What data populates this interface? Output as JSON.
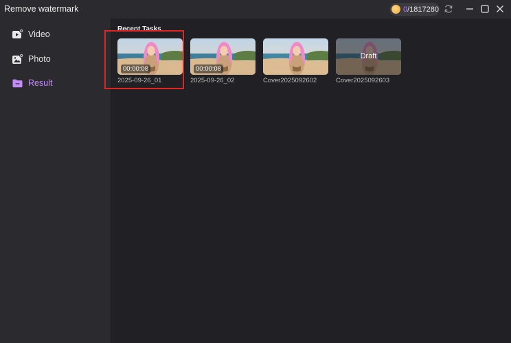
{
  "app": {
    "title": "Remove watermark"
  },
  "credits": {
    "used": "0",
    "total": "/1817280"
  },
  "window_icons": [
    "refresh-icon",
    "minimize-icon",
    "maximize-icon",
    "close-icon"
  ],
  "sidebar": {
    "items": [
      {
        "label": "Video",
        "icon": "video-icon",
        "active": false
      },
      {
        "label": "Photo",
        "icon": "photo-icon",
        "active": false
      },
      {
        "label": "Result",
        "icon": "folder-icon",
        "active": true
      }
    ]
  },
  "main": {
    "section_title": "Recent Tasks",
    "tasks": [
      {
        "name": "2025-09-26_01",
        "duration": "00:00:08"
      },
      {
        "name": "2025-09-26_02",
        "duration": "00:00:08"
      },
      {
        "name": "Cover2025092602"
      },
      {
        "name": "Cover2025092603",
        "overlay": "Draft"
      }
    ]
  },
  "colors": {
    "accent": "#c68aff",
    "highlight": "#e02424",
    "sidebar": "#2b2b2f",
    "background": "#212125"
  }
}
